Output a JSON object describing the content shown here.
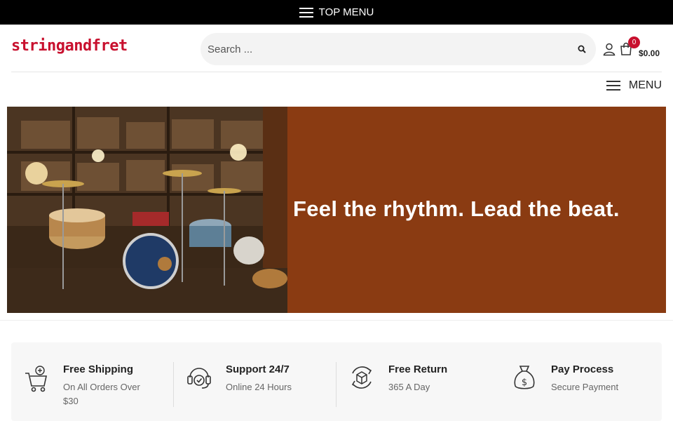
{
  "topbar": {
    "label": "TOP MENU"
  },
  "header": {
    "logo": "stringandfret",
    "search_placeholder": "Search ...",
    "cart_count": "0",
    "cart_total": "$0.00"
  },
  "nav": {
    "menu_label": "MENU"
  },
  "hero": {
    "tagline": "Feel the rhythm. Lead the beat."
  },
  "features": [
    {
      "title": "Free Shipping",
      "subtitle": "On All Orders Over $30",
      "icon": "cart-plus-icon"
    },
    {
      "title": "Support 24/7",
      "subtitle": "Online 24 Hours",
      "icon": "headset-icon"
    },
    {
      "title": "Free Return",
      "subtitle": "365 A Day",
      "icon": "return-box-icon"
    },
    {
      "title": "Pay Process",
      "subtitle": "Secure Payment",
      "icon": "money-bag-icon"
    }
  ],
  "colors": {
    "brand": "#c8102e",
    "topbar": "#000000",
    "hero_panel": "#8a3b12"
  }
}
